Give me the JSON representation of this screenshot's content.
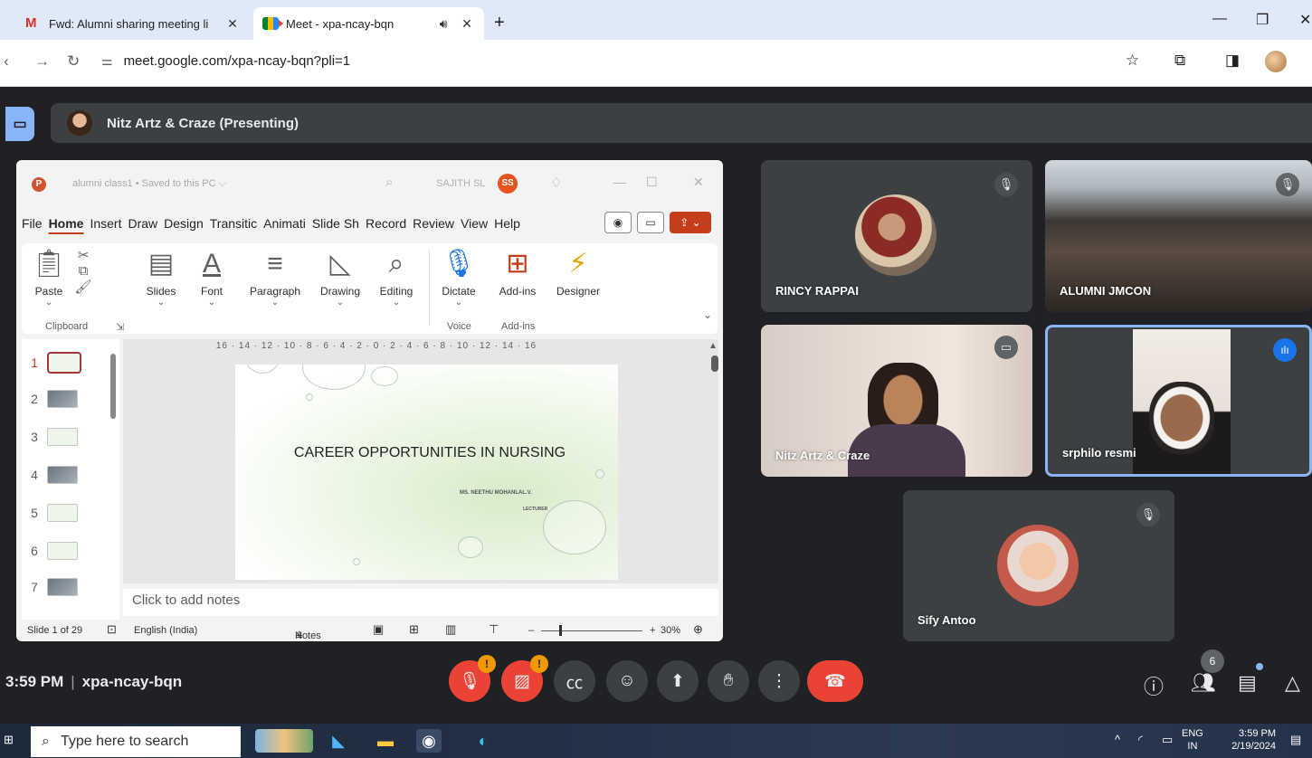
{
  "browser": {
    "tabs": [
      {
        "label": "Fwd: Alumni sharing meeting li",
        "favicon": "gmail-icon",
        "active": false
      },
      {
        "label": "Meet - xpa-ncay-bqn",
        "favicon": "meet-icon",
        "active": true
      }
    ],
    "url": "meet.google.com/xpa-ncay-bqn?pli=1"
  },
  "presenting": {
    "label": "Nitz Artz & Craze (Presenting)"
  },
  "ppt": {
    "doc_title": "alumni class1 • Saved to this PC ⌵",
    "user": "SAJITH SL",
    "user_initials": "SS",
    "menu": [
      "File",
      "Home",
      "Insert",
      "Draw",
      "Design",
      "Transitic",
      "Animati",
      "Slide Sh",
      "Record",
      "Review",
      "View",
      "Help"
    ],
    "ribbon": {
      "paste": "Paste",
      "slides": "Slides",
      "font": "Font",
      "paragraph": "Paragraph",
      "drawing": "Drawing",
      "editing": "Editing",
      "dictate": "Dictate",
      "addins": "Add-ins",
      "designer": "Designer",
      "group_clipboard": "Clipboard",
      "group_voice": "Voice",
      "group_addins": "Add-ins"
    },
    "thumbnails": [
      "1",
      "2",
      "3",
      "4",
      "5",
      "6",
      "7"
    ],
    "ruler": "16 · 14 · 12 · 10 · 8 · 6 · 4 · 2 · 0 · 2 · 4 · 6 · 8 · 10 · 12 · 14 · 16",
    "slide": {
      "title": "CAREER OPPORTUNITIES IN NURSING",
      "author": "MS. NEETHU MOHANLAL.V.",
      "role": "LECTURER"
    },
    "notes_placeholder": "Click to add notes",
    "status": {
      "slide_info": "Slide 1 of 29",
      "language": "English (India)",
      "notes": "Notes",
      "zoom": "30%"
    }
  },
  "participants": [
    {
      "name": "RINCY RAPPAI",
      "muted": true
    },
    {
      "name": "ALUMNI JMCON",
      "muted": true
    },
    {
      "name": "Nitz Artz & Craze",
      "muted": false
    },
    {
      "name": "srphilo resmi",
      "muted": false,
      "speaking": true
    },
    {
      "name": "Sify Antoo",
      "muted": true
    }
  ],
  "meeting": {
    "time": "3:59 PM",
    "separator": "|",
    "code": "xpa-ncay-bqn",
    "people_count": "6"
  },
  "taskbar": {
    "search_placeholder": "Type here to search",
    "lang_top": "ENG",
    "lang_bottom": "IN",
    "time": "3:59 PM",
    "date": "2/19/2024"
  },
  "colors": {
    "meet_bg": "#202124",
    "tile_bg": "#3c4043",
    "accent_blue": "#8ab4f8",
    "danger_red": "#ea4335",
    "ppt_orange": "#c43e1c"
  }
}
